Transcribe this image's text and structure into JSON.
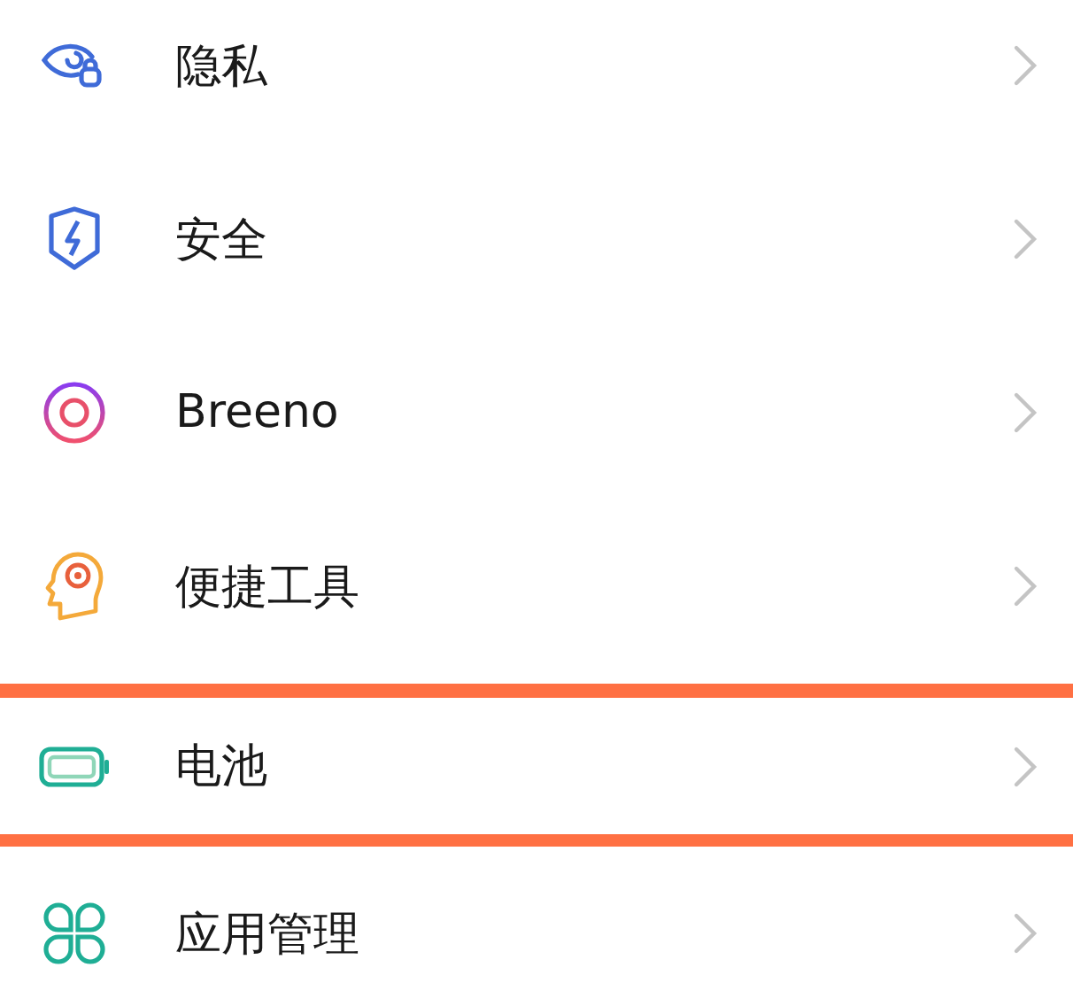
{
  "settings_items": [
    {
      "label": "隐私",
      "highlighted": false
    },
    {
      "label": "安全",
      "highlighted": false
    },
    {
      "label": "Breeno",
      "highlighted": false
    },
    {
      "label": "便捷工具",
      "highlighted": false
    },
    {
      "label": "电池",
      "highlighted": true
    },
    {
      "label": "应用管理",
      "highlighted": false
    }
  ]
}
